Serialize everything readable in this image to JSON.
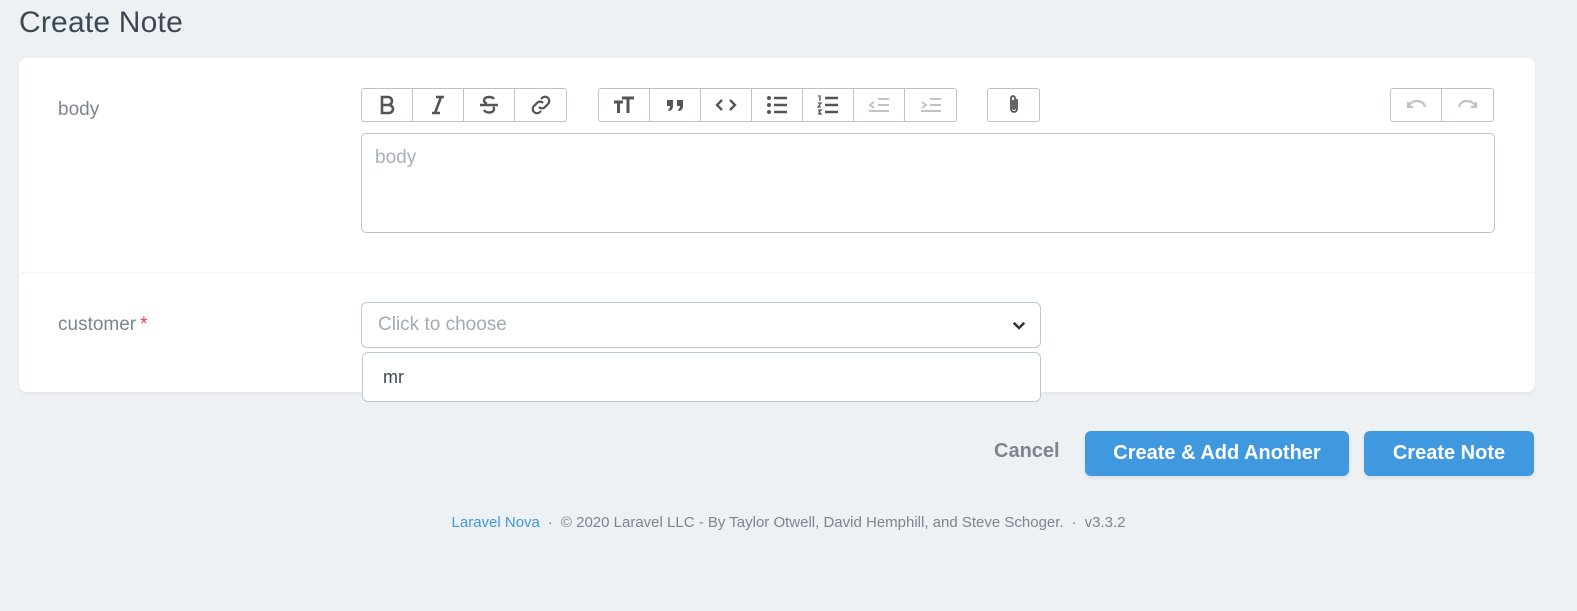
{
  "page": {
    "title": "Create Note"
  },
  "fields": {
    "body": {
      "label": "body",
      "placeholder": "body"
    },
    "customer": {
      "label": "customer",
      "required_marker": "*",
      "placeholder": "Click to choose",
      "search_value": "mr"
    }
  },
  "toolbar": {
    "groups": [
      [
        "bold-icon",
        "italic-icon",
        "strikethrough-icon",
        "link-icon"
      ],
      [
        "heading-icon",
        "quote-icon",
        "code-icon",
        "bullet-list-icon",
        "numbered-list-icon",
        "decrease-indent-icon",
        "increase-indent-icon"
      ],
      [
        "attach-icon"
      ],
      [
        "undo-icon",
        "redo-icon"
      ]
    ]
  },
  "actions": {
    "cancel": "Cancel",
    "create_add_another": "Create & Add Another",
    "create": "Create Note"
  },
  "footer": {
    "link": "Laravel Nova",
    "separator": "·",
    "copyright": "© 2020 Laravel LLC - By Taylor Otwell, David Hemphill, and Steve Schoger.",
    "version": "v3.3.2"
  },
  "colors": {
    "primary": "#4099de",
    "required": "#e74444",
    "background": "#eef1f4"
  }
}
